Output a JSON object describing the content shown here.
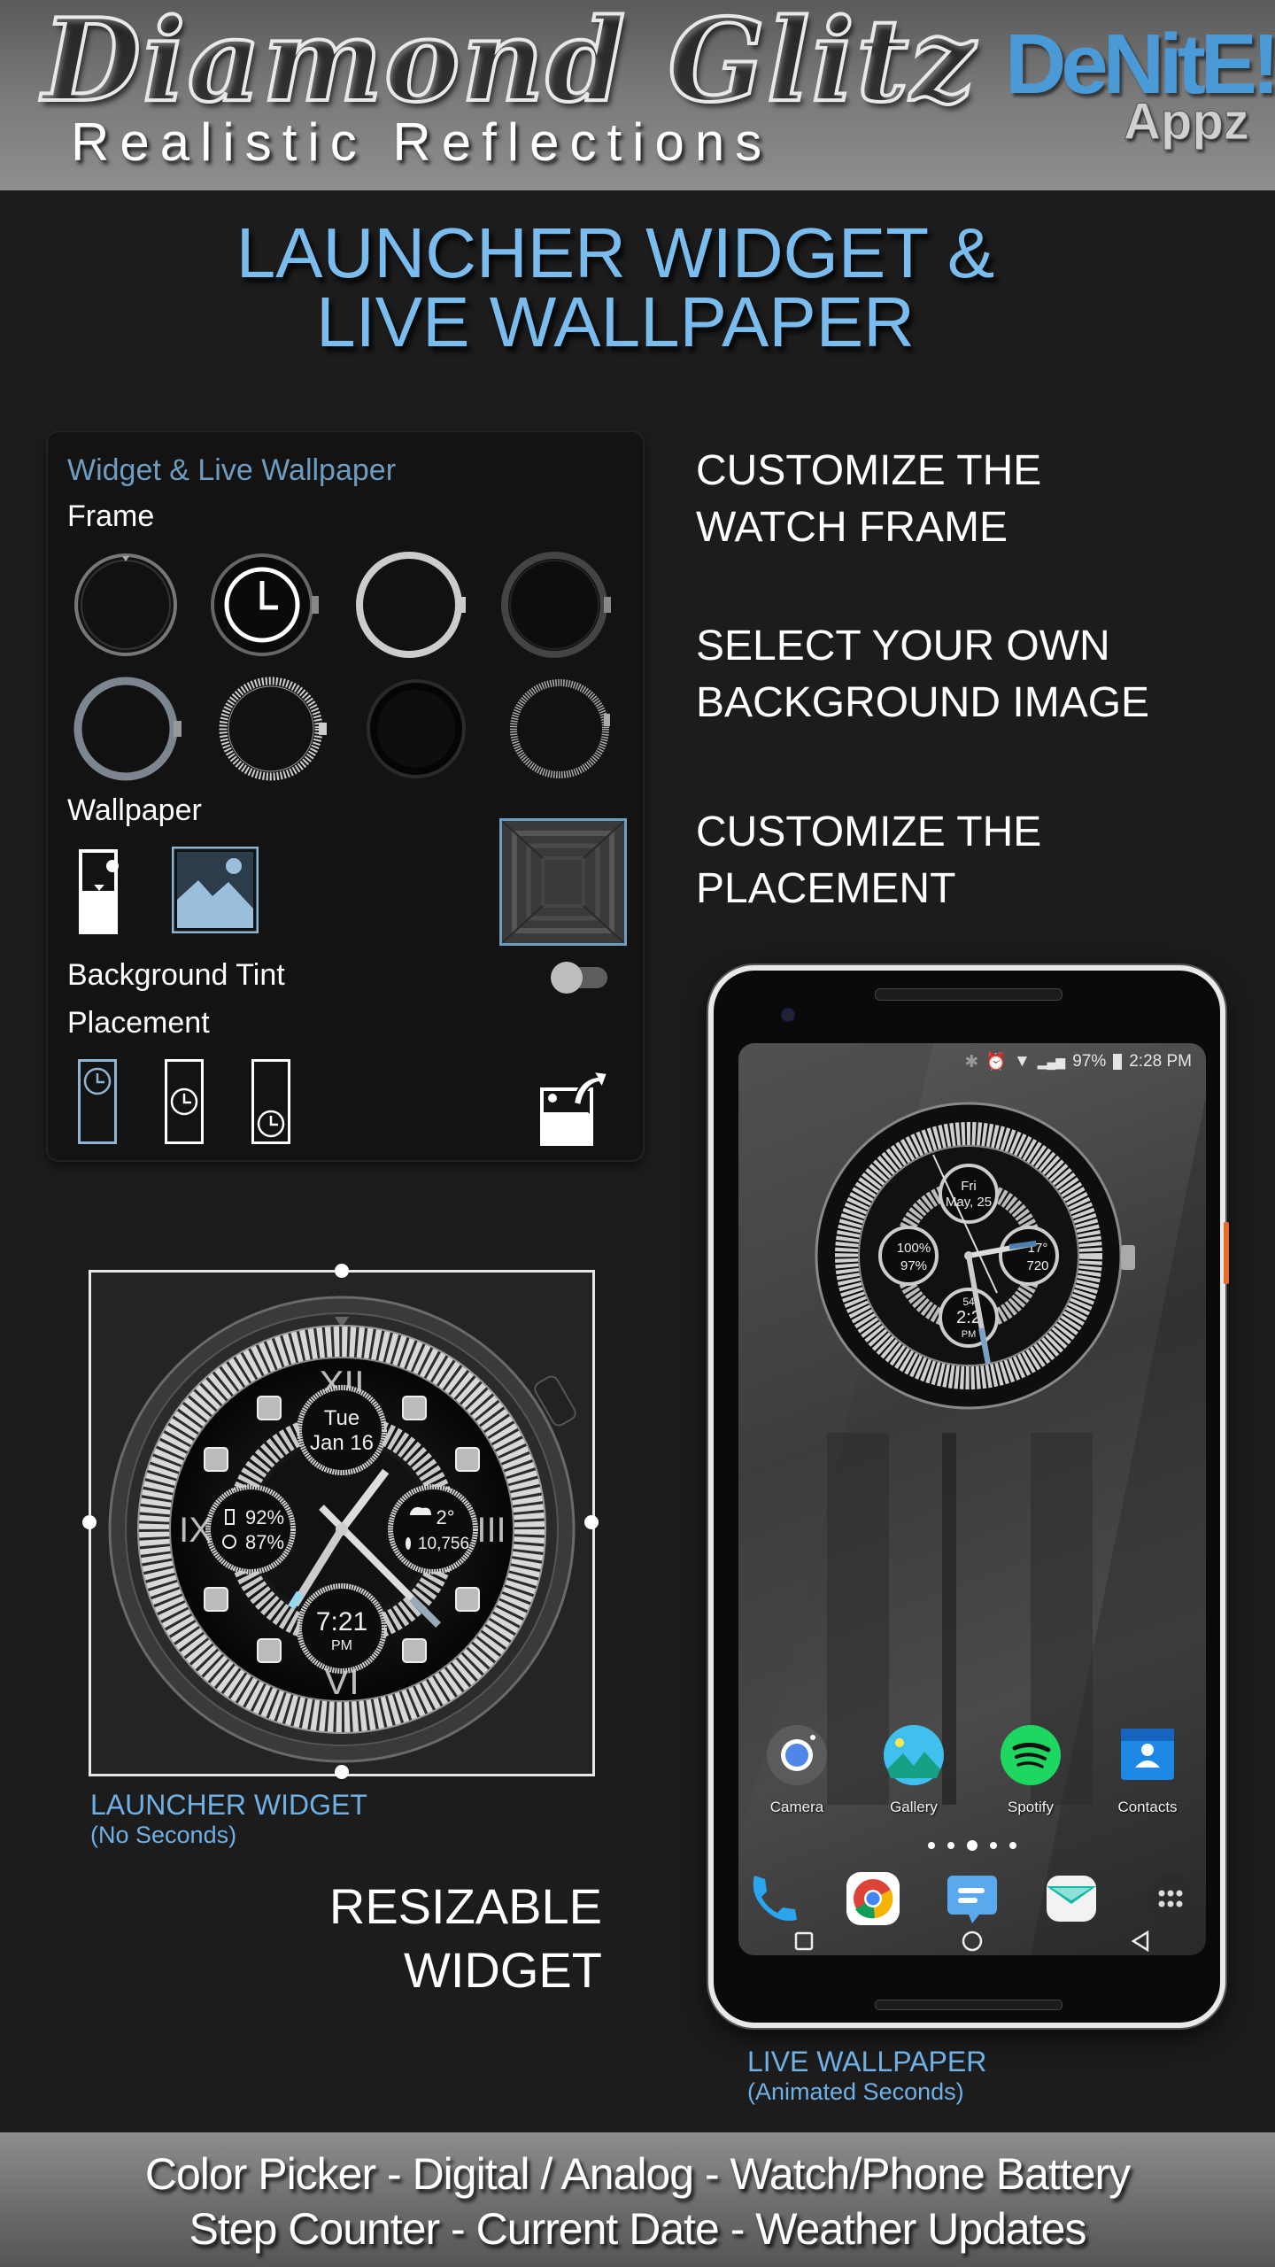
{
  "header": {
    "title": "Diamond Glitz",
    "subtitle": "Realistic Reflections",
    "brand_main": "DeNitE!",
    "brand_sub": "Appz"
  },
  "headline": {
    "line1": "LAUNCHER WIDGET &",
    "line2": "LIVE WALLPAPER"
  },
  "settings_panel": {
    "title": "Widget & Live Wallpaper",
    "frame_label": "Frame",
    "frame_options": [
      {
        "name": "frame-1",
        "style": "dark-bezel-ticks"
      },
      {
        "name": "frame-2",
        "style": "black-chrono-selected",
        "selected": true
      },
      {
        "name": "frame-3",
        "style": "silver-polished"
      },
      {
        "name": "frame-4",
        "style": "black-polished"
      },
      {
        "name": "frame-5",
        "style": "blue-steel"
      },
      {
        "name": "frame-6",
        "style": "diamond-studded"
      },
      {
        "name": "frame-7",
        "style": "black-matte"
      },
      {
        "name": "frame-8",
        "style": "silver-knurled"
      }
    ],
    "wallpaper_label": "Wallpaper",
    "wallpaper_options": [
      "portrait-image",
      "landscape-image-selected"
    ],
    "background_tint_label": "Background Tint",
    "background_tint_on": false,
    "placement_label": "Placement",
    "placement_options": [
      "top",
      "middle",
      "bottom"
    ],
    "placement_selected": "top",
    "accent_color": "#6e9dc2"
  },
  "features": {
    "f1_line1": "CUSTOMIZE THE",
    "f1_line2": "WATCH FRAME",
    "f2_line1": "SELECT YOUR OWN",
    "f2_line2": "BACKGROUND IMAGE",
    "f3_line1": "CUSTOMIZE THE",
    "f3_line2": "PLACEMENT"
  },
  "widget_watch": {
    "day": "Tue",
    "date": "Jan 16",
    "phone_battery": "92%",
    "watch_battery": "87%",
    "weather_temp": "2°",
    "steps": "10,756",
    "time": "7:21",
    "ampm": "PM",
    "numeral_top": "XII",
    "numeral_left": "IX",
    "numeral_right": "III",
    "numeral_bottom": "VI"
  },
  "widget_caption": {
    "line1": "LAUNCHER WIDGET",
    "line2": "(No Seconds)"
  },
  "resizable": {
    "line1": "RESIZABLE",
    "line2": "WIDGET"
  },
  "phone": {
    "status": {
      "battery": "97%",
      "time": "2:28 PM"
    },
    "wallpaper_watch": {
      "day": "Fri",
      "date": "May, 25",
      "watch_battery": "100%",
      "phone_battery": "97%",
      "weather_temp": "17°",
      "steps": "720",
      "seconds": "54",
      "time": "2:2",
      "ampm": "PM"
    },
    "apps": [
      {
        "label": "Camera",
        "color": "#5b5b5b"
      },
      {
        "label": "Gallery",
        "color": "#3fc0ee"
      },
      {
        "label": "Spotify",
        "color": "#1ed760"
      },
      {
        "label": "Contacts",
        "color": "#1e88e5"
      }
    ],
    "page_count": 5,
    "active_page": 3,
    "dock": [
      "Phone",
      "Chrome",
      "Messages",
      "Email",
      "App Drawer"
    ]
  },
  "phone_caption": {
    "line1": "LIVE WALLPAPER",
    "line2": "(Animated Seconds)"
  },
  "footer": {
    "line1": "Color Picker - Digital / Analog - Watch/Phone Battery",
    "line2": "Step Counter - Current Date - Weather Updates"
  }
}
